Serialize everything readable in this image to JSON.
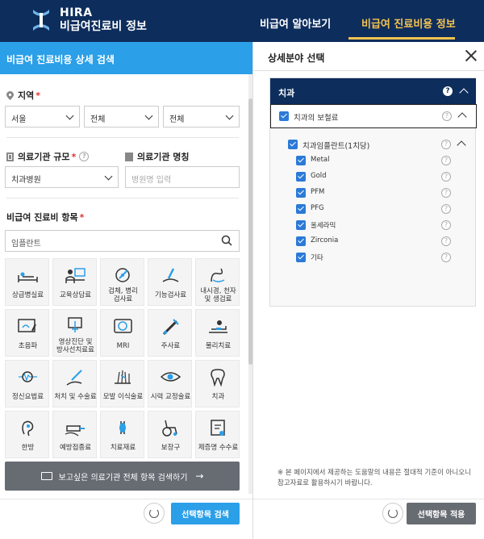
{
  "header": {
    "logo_en": "HIRA",
    "logo_ko": "비급여진료비 정보",
    "nav": [
      "비급여 알아보기",
      "비급여 진료비용 정보"
    ]
  },
  "left": {
    "title": "비급여 진료비용 상세 검색",
    "region": {
      "label": "지역",
      "selects": [
        "서울",
        "전체",
        "전체"
      ]
    },
    "facility_size": {
      "label": "의료기관 규모",
      "value": "치과병원"
    },
    "facility_name": {
      "label": "의료기관 명칭",
      "placeholder": "병원명 입력"
    },
    "items": {
      "label": "비급여 진료비 항목",
      "search_value": "임플란트"
    },
    "grid": [
      {
        "label": "상급병실료",
        "icon": "bed-icon"
      },
      {
        "label": "교육상담료",
        "icon": "consult-icon"
      },
      {
        "label": "검체, 병리\n검사료",
        "icon": "microscope-icon"
      },
      {
        "label": "기능검사료",
        "icon": "function-test-icon"
      },
      {
        "label": "내시경, 천자\n및 생검료",
        "icon": "endoscope-icon"
      },
      {
        "label": "초음파",
        "icon": "ultrasound-icon"
      },
      {
        "label": "영상진단 및\n방사선치료료",
        "icon": "radiology-icon"
      },
      {
        "label": "MRI",
        "icon": "mri-icon"
      },
      {
        "label": "주사료",
        "icon": "syringe-icon"
      },
      {
        "label": "물리치료",
        "icon": "physio-icon"
      },
      {
        "label": "정신요법료",
        "icon": "brain-icon"
      },
      {
        "label": "처치 및 수술료",
        "icon": "surgery-icon"
      },
      {
        "label": "모발 이식술료",
        "icon": "hair-icon"
      },
      {
        "label": "시력 교정술료",
        "icon": "eye-icon"
      },
      {
        "label": "치과",
        "icon": "tooth-icon"
      },
      {
        "label": "한방",
        "icon": "ear-icon"
      },
      {
        "label": "예방접종료",
        "icon": "vaccine-icon"
      },
      {
        "label": "치료재료",
        "icon": "material-icon"
      },
      {
        "label": "보장구",
        "icon": "wheelchair-icon"
      },
      {
        "label": "제증명 수수료",
        "icon": "certificate-icon"
      }
    ],
    "search_all_btn": "보고싶은 의료기관 전체 항목 검색하기",
    "apply_btn": "선택항목 검색"
  },
  "right": {
    "title": "상세분야 선택",
    "category": "치과",
    "subcategory": "치과의 보철료",
    "group": "치과임플란트(1치당)",
    "options": [
      "Metal",
      "Gold",
      "PFM",
      "PFG",
      "올세라믹",
      "Zirconia",
      "기타"
    ],
    "note": "※ 본 페이지에서 제공하는 도움말의 내용은 절대적 기준이 아니오니참고자료로 활용하시기 바랍니다.",
    "apply_btn": "선택항목 적용"
  },
  "colors": {
    "navy": "#0d2d5c",
    "blue": "#2b9fe8",
    "gold": "#f6c350",
    "red": "#e0312f"
  }
}
